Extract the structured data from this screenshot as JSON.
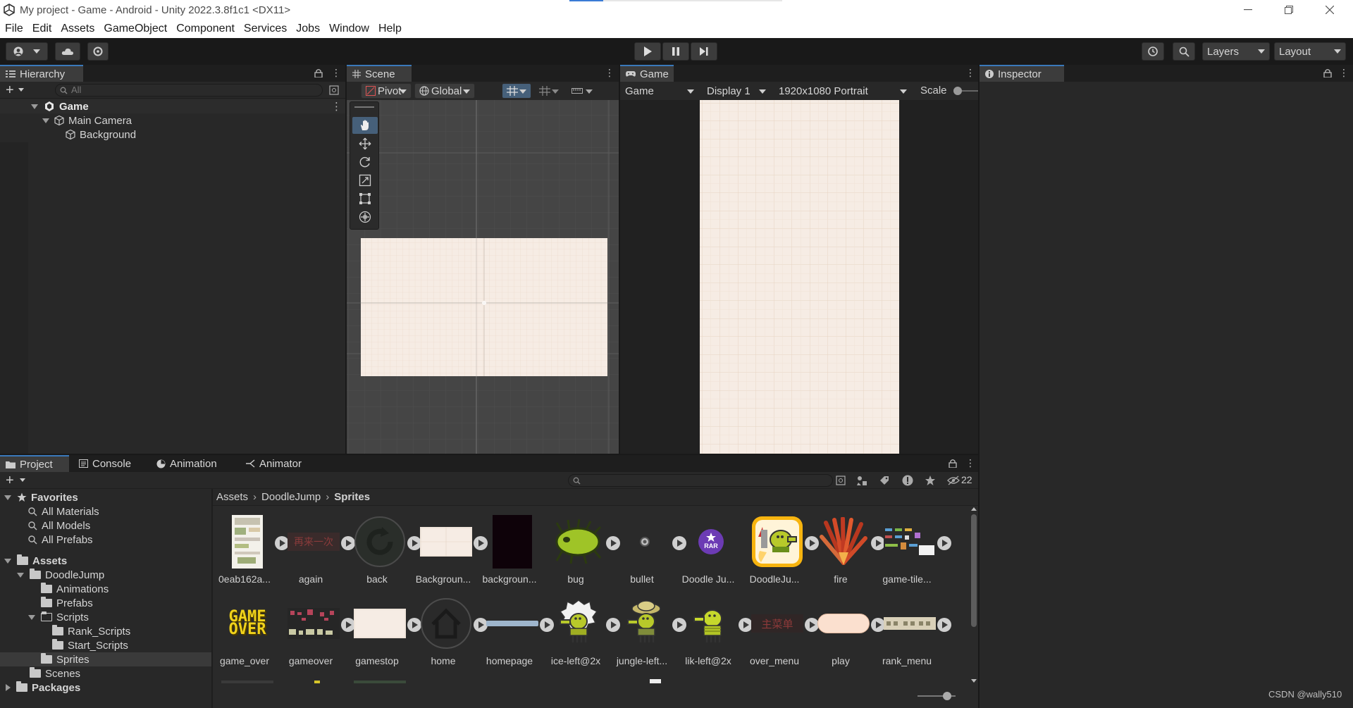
{
  "window": {
    "title": "My project - Game - Android - Unity 2022.3.8f1c1 <DX11>",
    "loading_progress": 0.16
  },
  "menu": [
    "File",
    "Edit",
    "Assets",
    "GameObject",
    "Component",
    "Services",
    "Jobs",
    "Window",
    "Help"
  ],
  "toolbar": {
    "layers_label": "Layers",
    "layout_label": "Layout"
  },
  "hierarchy": {
    "tab_label": "Hierarchy",
    "search_placeholder": "All",
    "scene_name": "Game",
    "items": [
      "Main Camera",
      "Background"
    ]
  },
  "scene": {
    "tab_label": "Scene",
    "pivot_label": "Pivot",
    "global_label": "Global"
  },
  "game": {
    "tab_label": "Game",
    "view_select": "Game",
    "display_select": "Display 1",
    "resolution_select": "1920x1080 Portrait",
    "scale_label": "Scale"
  },
  "inspector": {
    "tab_label": "Inspector"
  },
  "bottom_tabs": [
    "Project",
    "Console",
    "Animation",
    "Animator"
  ],
  "project": {
    "hidden_count": "22",
    "breadcrumb": [
      "Assets",
      "DoodleJump",
      "Sprites"
    ],
    "tree": {
      "favorites_label": "Favorites",
      "favorites": [
        "All Materials",
        "All Models",
        "All Prefabs"
      ],
      "assets_label": "Assets",
      "doodlejump_label": "DoodleJump",
      "animations_label": "Animations",
      "prefabs_label": "Prefabs",
      "scripts_label": "Scripts",
      "rank_scripts_label": "Rank_Scripts",
      "start_scripts_label": "Start_Scripts",
      "sprites_label": "Sprites",
      "scenes_label": "Scenes",
      "packages_label": "Packages"
    },
    "assets_row1": [
      "0eab162a...",
      "again",
      "back",
      "Backgroun...",
      "backgroun...",
      "bug",
      "bullet",
      "Doodle Ju...",
      "DoodleJu...",
      "fire",
      "game-tile..."
    ],
    "assets_row2": [
      "game_over",
      "gameover",
      "gamestop",
      "home",
      "homepage",
      "ice-left@2x",
      "jungle-left...",
      "lik-left@2x",
      "over_menu",
      "play",
      "rank_menu"
    ],
    "thumb_text": {
      "again": "再来一次",
      "game_over_line1": "GAME",
      "game_over_line2": "OVER",
      "over_menu": "主菜单",
      "rar": "RAR"
    }
  },
  "watermark": "CSDN @wally510",
  "colors": {
    "accent": "#3a79bb",
    "panel": "#282828",
    "paper": "#f6ece4",
    "doodle_green": "#b8c92a"
  }
}
